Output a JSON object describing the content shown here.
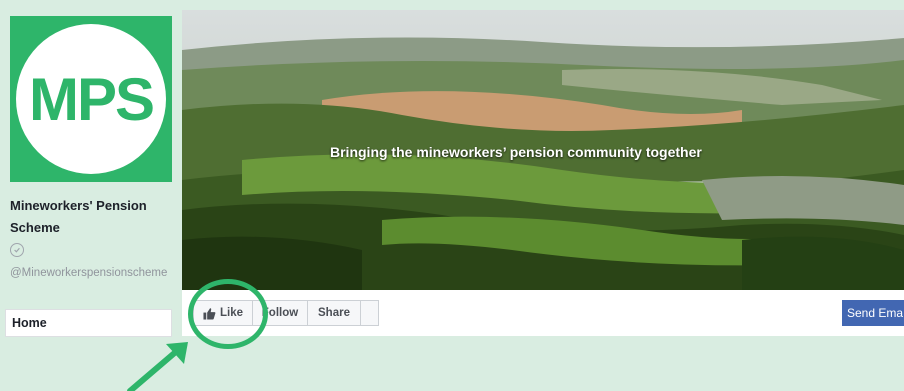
{
  "colors": {
    "brand_green": "#2eb56a",
    "facebook_blue": "#4267b2",
    "background": "#d9ede1"
  },
  "sidebar": {
    "logo_text": "MPS",
    "page_name": "Mineworkers' Pension Scheme",
    "handle": "@Mineworkerspensionscheme",
    "nav_items": [
      {
        "label": "Home"
      }
    ]
  },
  "cover": {
    "tagline": "Bringing the mineworkers’ pension community together"
  },
  "actions": {
    "like_label": "Like",
    "follow_label": "Follow",
    "share_label": "Share",
    "send_email_label": "Send Email"
  },
  "icons": [
    "verified-check-icon",
    "thumbs-up-icon",
    "arrow-annotation-icon"
  ]
}
